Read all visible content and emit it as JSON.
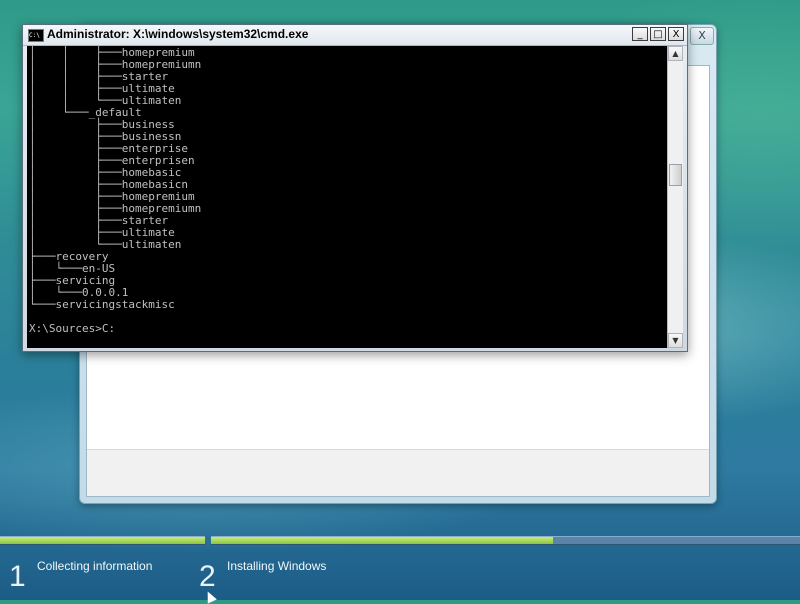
{
  "cmd": {
    "title": "Administrator: X:\\windows\\system32\\cmd.exe",
    "icon_label": "C:\\",
    "buttons": {
      "minimize": "_",
      "maximize": "□",
      "close": "X"
    },
    "output_lines": [
      "│    │    ├───homepremium",
      "│    │    ├───homepremiumn",
      "│    │    ├───starter",
      "│    │    ├───ultimate",
      "│    │    └───ultimaten",
      "│    └───_default",
      "│         ├───business",
      "│         ├───businessn",
      "│         ├───enterprise",
      "│         ├───enterprisen",
      "│         ├───homebasic",
      "│         ├───homebasicn",
      "│         ├───homepremium",
      "│         ├───homepremiumn",
      "│         ├───starter",
      "│         ├───ultimate",
      "│         └───ultimaten",
      "├───recovery",
      "│   └───en-US",
      "├───servicing",
      "│   └───0.0.0.1",
      "└───servicingstackmisc",
      "",
      "X:\\Sources>C:"
    ]
  },
  "setup_window": {
    "close_label": "X"
  },
  "progress": {
    "steps": [
      {
        "number": "1",
        "label": "Collecting information",
        "progress": 1.0
      },
      {
        "number": "2",
        "label": "Installing Windows",
        "progress": 0.58
      }
    ]
  },
  "colors": {
    "progress_fill": "#8cc63f",
    "progress_track": "#5a85a8",
    "console_bg": "#000000",
    "console_fg": "#c0c0c0"
  }
}
